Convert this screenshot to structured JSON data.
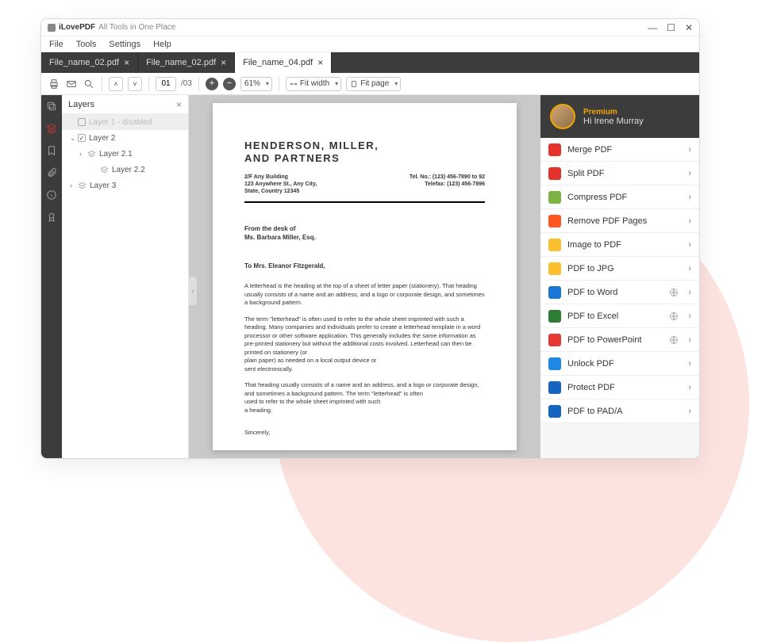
{
  "titlebar": {
    "app": "iLovePDF",
    "subtitle": "All Tools in One Place"
  },
  "menubar": [
    "File",
    "Tools",
    "Settings",
    "Help"
  ],
  "tabs": [
    {
      "label": "File_name_02.pdf",
      "active": false
    },
    {
      "label": "File_name_02.pdf",
      "active": false
    },
    {
      "label": "File_name_04.pdf",
      "active": true
    }
  ],
  "toolbar": {
    "page_current": "01",
    "page_total": "/03",
    "zoom_value": "61%",
    "fit_width": "Fit width",
    "fit_page": "Fit page"
  },
  "layers": {
    "title": "Layers",
    "items": [
      {
        "indent": 1,
        "toggle": "",
        "checked": false,
        "name": "Layer 1 - disabled",
        "disabled": true,
        "stack": false
      },
      {
        "indent": 1,
        "toggle": "⌄",
        "checked": true,
        "name": "Layer 2",
        "stack": false
      },
      {
        "indent": 2,
        "toggle": "›",
        "checked": null,
        "name": "Layer 2.1",
        "stack": true
      },
      {
        "indent": 3,
        "toggle": "",
        "checked": null,
        "name": "Layer 2.2",
        "stack": true
      },
      {
        "indent": 1,
        "toggle": "›",
        "checked": null,
        "name": "Layer 3",
        "stack": true
      }
    ]
  },
  "document": {
    "heading1": "HENDERSON, MILLER,",
    "heading2": "AND PARTNERS",
    "addr1": "2/F Any Building",
    "addr2": "123 Anywhere St., Any City,",
    "addr3": "State, Country 12345",
    "tel": "Tel. No.: (123) 456-7890 to 92",
    "fax": "Telefax: (123) 456-7896",
    "desk1": "From the desk of",
    "desk2": "Ms. Barbara Miller, Esq.",
    "to": "To Mrs. Eleanor Fitzgerald,",
    "p1": "A letterhead is the heading at the top of a sheet of letter paper (stationery). That heading usually consists of a name and an address, and a logo or corporate design, and sometimes a background pattern.",
    "p2": "The term \"letterhead\" is often used to refer to the whole sheet imprinted with such a heading. Many companies and individuals prefer to create a letterhead template in a word processor or other software application. This generally includes the same information as pre-printed stationery but without the additional costs involved. Letterhead can then be printed on stationery (or",
    "p2b": "plain paper) as needed on a local output device or",
    "p2c": "sent electronically.",
    "p3": "That heading usually consists of a name and an address, and a logo or corporate design, and sometimes a background pattern. The term \"letterhead\" is often",
    "p3b": "used to refer to the whole sheet imprinted with such",
    "p3c": "a heading.",
    "sincerely": "Sincerely,"
  },
  "user": {
    "premium": "Premium",
    "greeting": "Hi Irene Murray"
  },
  "tools": [
    {
      "label": "Merge PDF",
      "color": "#e5322d",
      "globe": false
    },
    {
      "label": "Split PDF",
      "color": "#e5322d",
      "globe": false
    },
    {
      "label": "Compress PDF",
      "color": "#7cb342",
      "globe": false
    },
    {
      "label": "Remove PDF Pages",
      "color": "#ff5722",
      "globe": false
    },
    {
      "label": "Image to PDF",
      "color": "#fbc02d",
      "globe": false
    },
    {
      "label": "PDF to JPG",
      "color": "#fbc02d",
      "globe": false
    },
    {
      "label": "PDF to Word",
      "color": "#1976d2",
      "globe": true
    },
    {
      "label": "PDF to Excel",
      "color": "#2e7d32",
      "globe": true
    },
    {
      "label": "PDF to PowerPoint",
      "color": "#e53935",
      "globe": true
    },
    {
      "label": "Unlock PDF",
      "color": "#1e88e5",
      "globe": false
    },
    {
      "label": "Protect PDF",
      "color": "#1565c0",
      "globe": false
    },
    {
      "label": "PDF to PAD/A",
      "color": "#1565c0",
      "globe": false
    }
  ]
}
